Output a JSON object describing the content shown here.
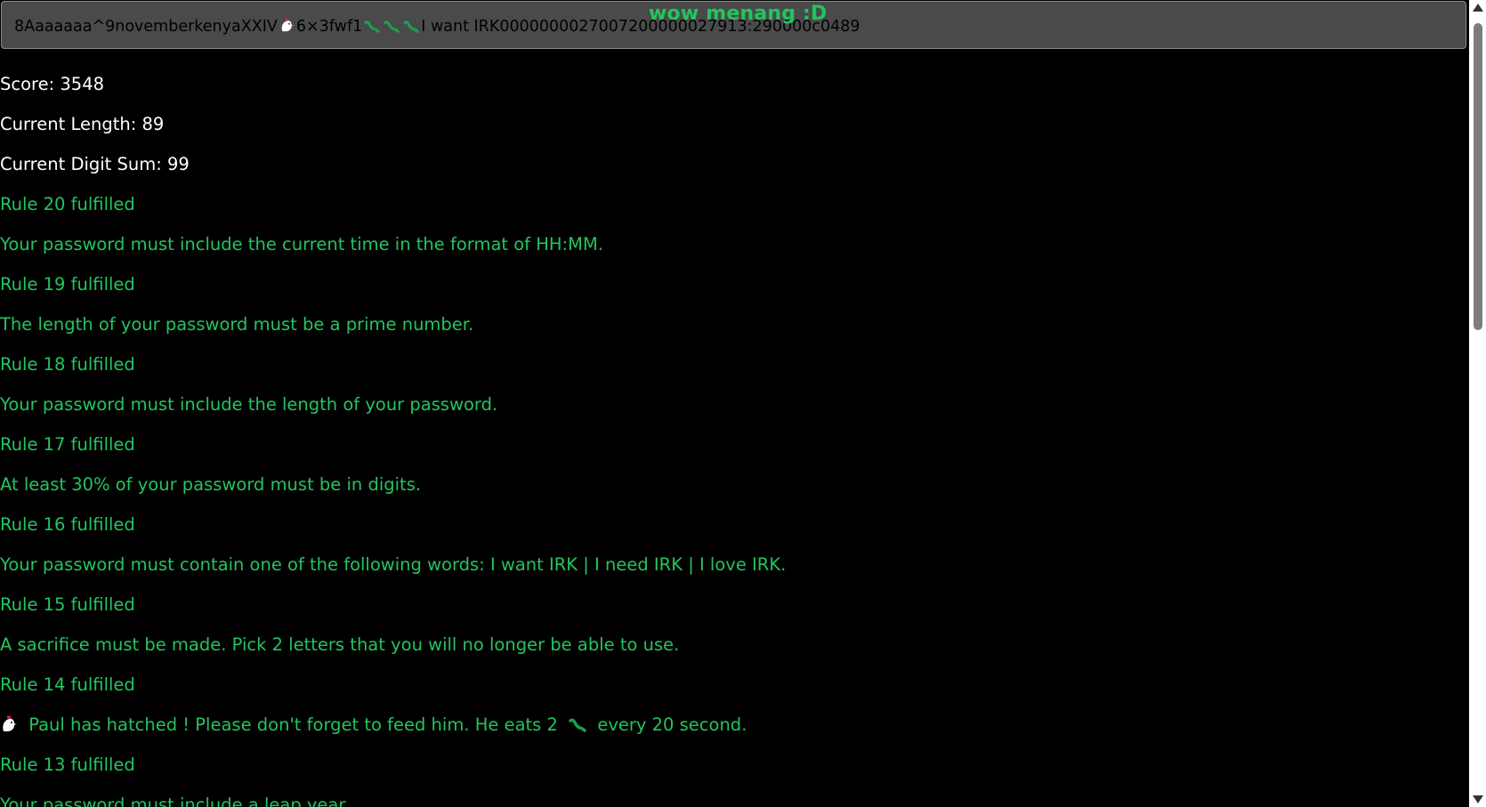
{
  "password": {
    "part1": "8Aaaaaaa^9novemberkenyaXXIV",
    "part2": "6×3fwf1",
    "part3": "I want IRK0000000027007200000027913:290000c0489"
  },
  "win_message": "wow menang :D",
  "stats": {
    "score": "Score: 3548",
    "length": "Current Length: 89",
    "digit_sum": "Current Digit Sum: 99"
  },
  "rules": [
    {
      "status": "Rule 20 fulfilled",
      "text": "Your password must include the current time in the format of HH:MM."
    },
    {
      "status": "Rule 19 fulfilled",
      "text": "The length of your password must be a prime number."
    },
    {
      "status": "Rule 18 fulfilled",
      "text": "Your password must include the length of your password."
    },
    {
      "status": "Rule 17 fulfilled",
      "text": "At least 30% of your password must be in digits."
    },
    {
      "status": "Rule 16 fulfilled",
      "text": "Your password must contain one of the following words: I want IRK | I need IRK | I love IRK."
    },
    {
      "status": "Rule 15 fulfilled",
      "text": "A sacrifice must be made. Pick 2 letters that you will no longer be able to use."
    },
    {
      "status": "Rule 14 fulfilled",
      "text_a": "Paul has hatched ! Please don't forget to feed him. He eats 2",
      "text_b": "every 20 second."
    },
    {
      "status": "Rule 13 fulfilled",
      "text": "Your password must include a leap year."
    }
  ],
  "icons": {
    "chick": "chick-icon",
    "worm": "worm-icon"
  },
  "colors": {
    "background": "#000000",
    "accent_green": "#22c55e",
    "input_bg": "#4a4a4a",
    "stat_text": "#ffffff"
  }
}
